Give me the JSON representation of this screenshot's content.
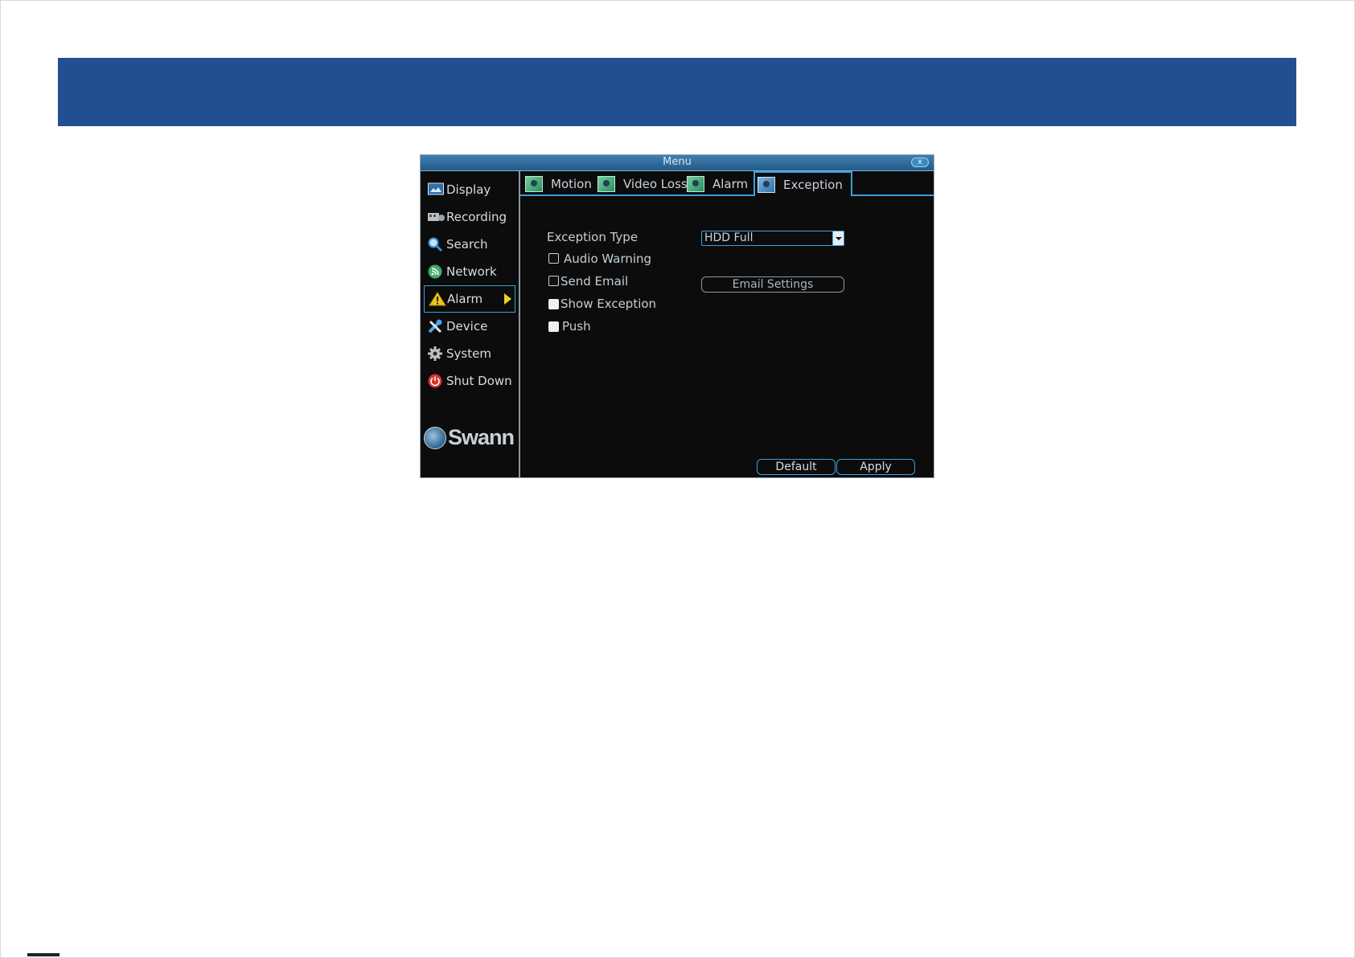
{
  "window": {
    "title": "Menu",
    "close_glyph": "x"
  },
  "sidebar": {
    "items": [
      {
        "label": "Display",
        "icon": "display-icon"
      },
      {
        "label": "Recording",
        "icon": "recording-icon"
      },
      {
        "label": "Search",
        "icon": "search-icon"
      },
      {
        "label": "Network",
        "icon": "network-icon"
      },
      {
        "label": "Alarm",
        "icon": "warning-icon",
        "active": true
      },
      {
        "label": "Device",
        "icon": "tools-icon"
      },
      {
        "label": "System",
        "icon": "gear-icon"
      },
      {
        "label": "Shut Down",
        "icon": "power-icon"
      }
    ],
    "logo_text": "Swann"
  },
  "tabs": [
    {
      "label": "Motion"
    },
    {
      "label": "Video Loss"
    },
    {
      "label": "Alarm"
    },
    {
      "label": "Exception",
      "active": true
    }
  ],
  "form": {
    "exception_type_label": "Exception Type",
    "exception_type_value": "HDD Full",
    "audio_warning_label": "Audio Warning",
    "send_email_label": "Send Email",
    "show_exception_label": "Show Exception",
    "push_label": "Push",
    "email_settings_button": "Email Settings"
  },
  "footer": {
    "default_button": "Default",
    "apply_button": "Apply"
  },
  "colors": {
    "banner": "#214f91",
    "accent": "#3aa0e0",
    "alarm_arrow": "#f1d21a",
    "window_bg": "#0c0c0c"
  }
}
